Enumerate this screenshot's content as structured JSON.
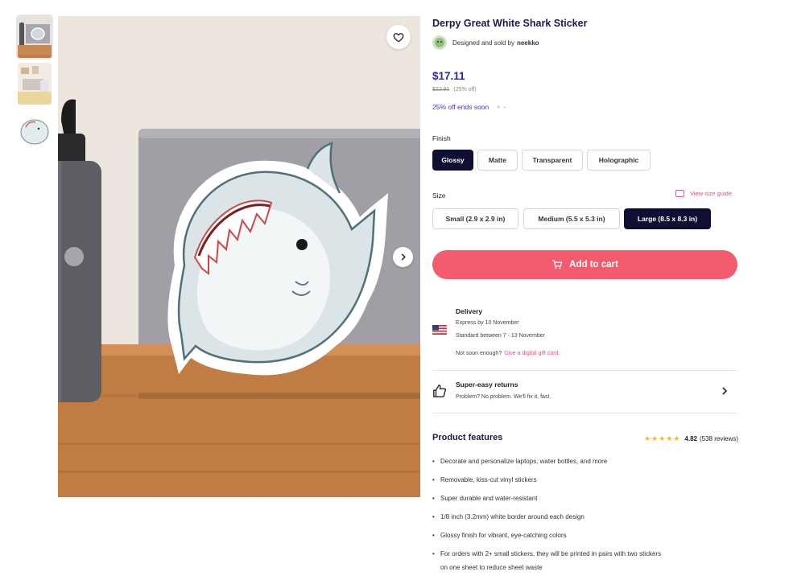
{
  "product": {
    "title": "Derpy Great White Shark Sticker",
    "designed_by_prefix": "Designed and sold by",
    "seller": "neekko"
  },
  "pricing": {
    "price": "$17.11",
    "old_price": "$22.81",
    "discount": "(25% off)",
    "promo_text": "25% off ends soon"
  },
  "finish": {
    "label": "Finish",
    "options": [
      "Glossy",
      "Matte",
      "Transparent",
      "Holographic"
    ],
    "selected": "Glossy"
  },
  "size": {
    "label": "Size",
    "guide_link": "View size guide",
    "options": [
      "Small (2.9 x 2.9 in)",
      "Medium (5.5 x 5.3 in)",
      "Large (8.5 x 8.3 in)"
    ],
    "selected": "Large (8.5 x 8.3 in)"
  },
  "cart": {
    "label": "Add to cart"
  },
  "delivery": {
    "title": "Delivery",
    "express": "Express by 10 November",
    "standard": "Standard between 7 - 13 November",
    "note": "Not soon enough?",
    "gift_link": "Give a digital gift card."
  },
  "returns": {
    "title": "Super-easy returns",
    "subtitle": "Problem? No problem. We'll fix it, fast."
  },
  "features": {
    "title": "Product features",
    "rating": "4.82",
    "reviews": "(538 reviews)",
    "stars": 5,
    "items": [
      "Decorate and personalize laptops, water bottles, and more",
      "Removable, kiss-cut vinyl stickers",
      "Super durable and water-resistant",
      "1/8 inch (3.2mm) white border around each design",
      "Glossy finish for vibrant, eye-catching colors",
      "For orders with 2+ small stickers, they will be printed in pairs with two stickers",
      "on one sheet to reduce sheet waste"
    ]
  },
  "colors": {
    "accent": "#f45b6e",
    "selected_option": "#0f0f33",
    "price": "#2b2a9a",
    "promo": "#3d3acb"
  },
  "icons": [
    "heart-icon",
    "chevron-right-icon",
    "cart-icon",
    "us-flag-icon",
    "thumbs-up-icon",
    "size-guide-icon",
    "star-icon"
  ]
}
